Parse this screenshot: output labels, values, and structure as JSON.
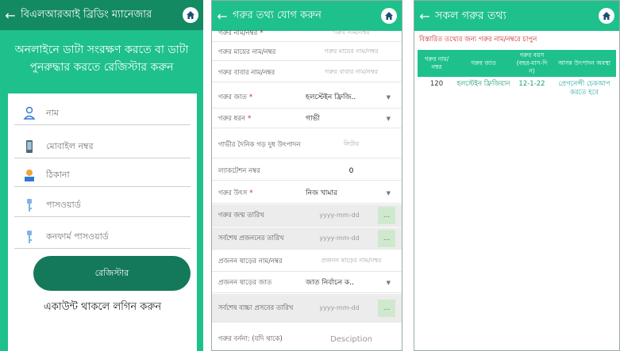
{
  "register": {
    "title": "বিএলআরআই ব্রিডিং ম্যানেজার",
    "headline": "অনলাইনে ডাটা সংরক্ষণ করতে বা ডাটা পুনরুদ্ধার করতে রেজিস্টার করুন",
    "fields": [
      {
        "placeholder": "নাম",
        "icon": "person-icon"
      },
      {
        "placeholder": "মোবাইল নম্বর",
        "icon": "phone-icon"
      },
      {
        "placeholder": "ঠিকানা",
        "icon": "address-icon"
      },
      {
        "placeholder": "পাসওয়ার্ড",
        "icon": "password-key-icon"
      },
      {
        "placeholder": "কনফার্ম পাসওয়ার্ড",
        "icon": "confirm-key-icon"
      }
    ],
    "register_button": "রেজিস্টার",
    "login_link": "একাউন্ট থাকলে লগিন করুন"
  },
  "add_cow": {
    "title": "গরুর তথ্য যোগ করুন",
    "rows": [
      {
        "label": "গরুর নাম/নম্বর",
        "required": "*",
        "placeholder": "গরুর নাম/নম্বর"
      },
      {
        "label": "গরুর মায়ের নাম/নম্বর",
        "placeholder": "গরুর মায়ের নাম/নম্বর"
      },
      {
        "label": "গরুর বাবার নাম/নম্বর",
        "placeholder": "গরুর বাবার নাম/নম্বর"
      },
      {
        "label": "গরুর জাত",
        "required": "*",
        "value": "হলস্টেইন ফ্রিজি.."
      },
      {
        "label": "গরুর ধরন",
        "required": "*",
        "value": "গাভী"
      },
      {
        "label": "গাভীর দৈনিক গড় দুধ উৎপাদন",
        "placeholder": "লিটার"
      },
      {
        "label": "ল্যাকটেশন নম্বর",
        "value": "0"
      },
      {
        "label": "গরুর উৎস",
        "required": "*",
        "value": "নিজ খামার"
      },
      {
        "label": "গরুর জন্ম তারিখ",
        "placeholder": "yyyy-mm-dd",
        "button": "..."
      },
      {
        "label": "সর্বশেষ প্রজননের তারিখ",
        "placeholder": "yyyy-mm-dd",
        "button": "..."
      },
      {
        "label": "প্রজনন ষাড়ের নাম/নম্বর",
        "placeholder": "প্রজনন ষাড়ের নাম/নম্বর"
      },
      {
        "label": "প্রজনন ষাড়ের জাত",
        "value": "জাত নির্বাচন ক.."
      },
      {
        "label": "সর্বশেষ বাচ্চা প্রসবের তারিখ",
        "placeholder": "yyyy-mm-dd",
        "button": "..."
      },
      {
        "label": "গরুর বর্ননা: (যদি থাকে)",
        "placeholder": "Desciption"
      }
    ]
  },
  "cow_list": {
    "title": "সকল গরুর তথ্য",
    "hint": "বিস্তারিত তথ্যের জন্য গরুর নাম/নম্বরে চাপুন",
    "headers": [
      "গরুর নাম/ নম্বর",
      "গরুর জাত",
      "গরুর বয়স (বছর-মাস-দি ন)",
      "আসন্ন উৎপাদন অবস্থা"
    ],
    "rows": [
      [
        "120",
        "হলস্টেইন ফ্রিজিয়ান",
        "12-1-22",
        "প্রেগনেন্সী চেকআপ করতে হবে"
      ]
    ]
  },
  "common": {
    "back_glyph": "←",
    "home_icon": "home-icon"
  },
  "colors": {
    "primary": "#1ec08c",
    "primary_dark": "#138a62",
    "button": "#14785a",
    "required": "#c62828"
  }
}
